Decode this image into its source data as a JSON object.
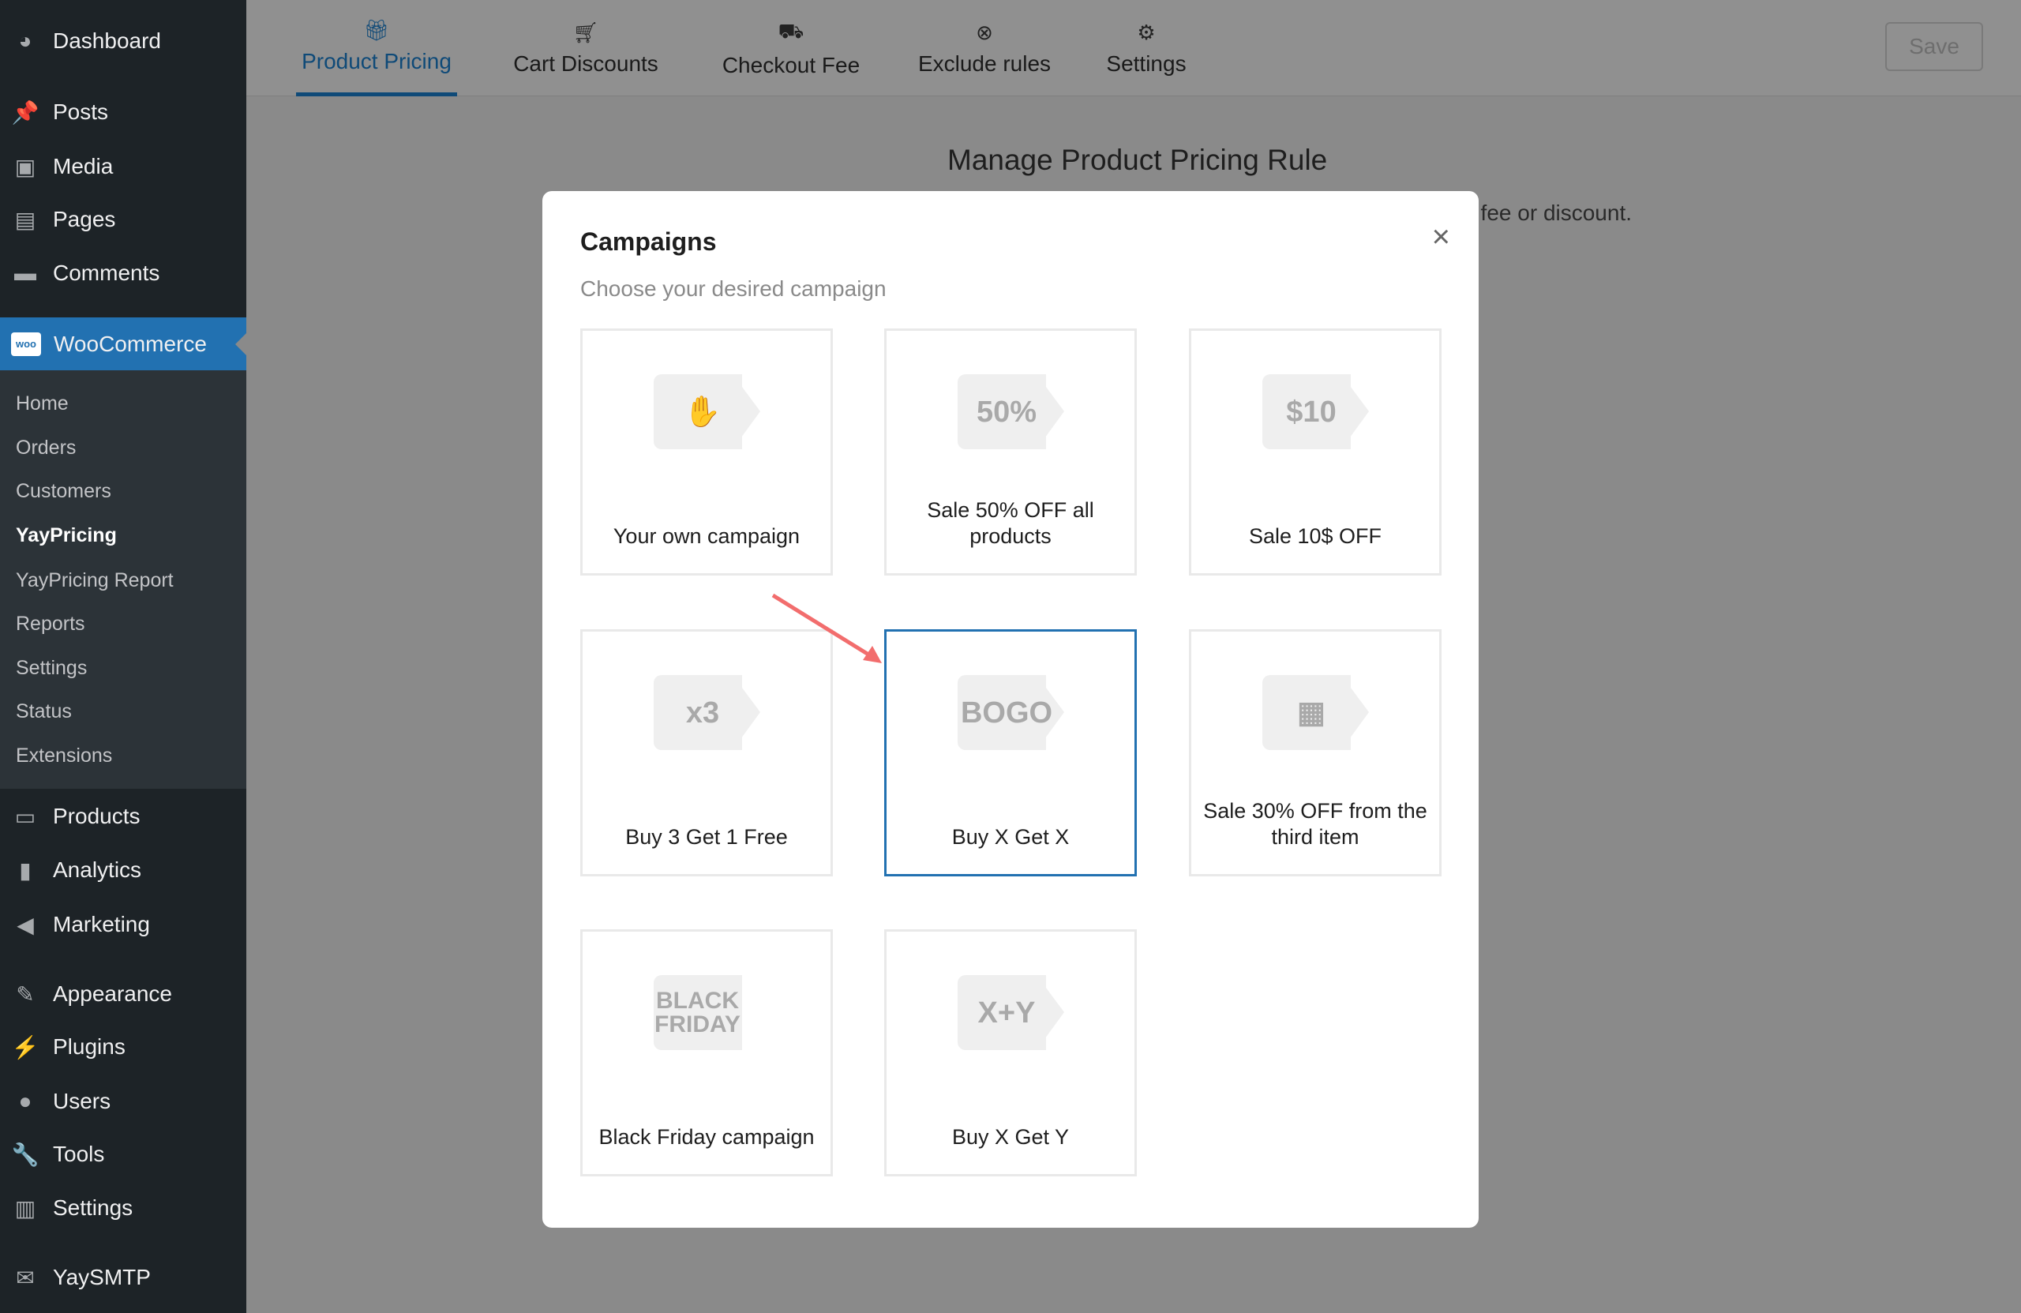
{
  "sidebar": {
    "top": [
      {
        "label": "Dashboard",
        "icon": "dashboard-icon"
      },
      {
        "label": "Posts",
        "icon": "pin-icon"
      },
      {
        "label": "Media",
        "icon": "media-icon"
      },
      {
        "label": "Pages",
        "icon": "pages-icon"
      },
      {
        "label": "Comments",
        "icon": "comment-icon"
      }
    ],
    "woo": {
      "label": "WooCommerce",
      "icon_text": "woo"
    },
    "submenu": [
      "Home",
      "Orders",
      "Customers",
      "YayPricing",
      "YayPricing Report",
      "Reports",
      "Settings",
      "Status",
      "Extensions"
    ],
    "bottom": [
      {
        "label": "Products"
      },
      {
        "label": "Analytics"
      },
      {
        "label": "Marketing"
      },
      {
        "label": "Appearance"
      },
      {
        "label": "Plugins"
      },
      {
        "label": "Users"
      },
      {
        "label": "Tools"
      },
      {
        "label": "Settings"
      },
      {
        "label": "YaySMTP"
      }
    ]
  },
  "tabs": [
    {
      "label": "Product Pricing",
      "icon": "gift-icon",
      "active": true
    },
    {
      "label": "Cart Discounts",
      "icon": "cart-icon"
    },
    {
      "label": "Checkout Fee",
      "icon": "car-icon"
    },
    {
      "label": "Exclude rules",
      "icon": "x-circle-icon"
    },
    {
      "label": "Settings",
      "icon": "gear-icon"
    }
  ],
  "save_label": "Save",
  "page": {
    "title": "Manage Product Pricing Rule",
    "desc": "t fee or discount."
  },
  "modal": {
    "title": "Campaigns",
    "subtitle": "Choose your desired campaign",
    "close": "×",
    "cards": [
      {
        "icon_text": "✋",
        "label": "Your own campaign"
      },
      {
        "icon_text": "50%",
        "label": "Sale 50% OFF all products"
      },
      {
        "icon_text": "$10",
        "label": "Sale 10$ OFF"
      },
      {
        "icon_text": "x3",
        "label": "Buy 3 Get 1 Free"
      },
      {
        "icon_text": "BOGO",
        "label": "Buy X Get X",
        "selected": true
      },
      {
        "icon_text": "▦",
        "label": "Sale 30% OFF from the third item"
      },
      {
        "icon_text": "BLACK FRIDAY",
        "label": "Black Friday campaign"
      },
      {
        "icon_text": "X+Y",
        "label": "Buy X Get Y"
      }
    ]
  }
}
